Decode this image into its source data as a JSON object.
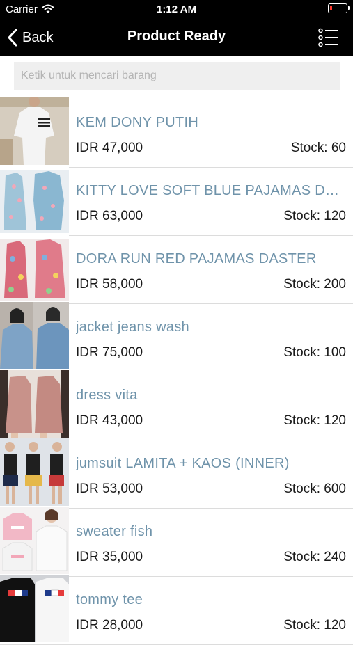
{
  "status_bar": {
    "carrier": "Carrier",
    "time": "1:12 AM",
    "battery_color": "#ff3b30"
  },
  "nav": {
    "back_label": "Back",
    "title": "Product Ready",
    "menu_icon": "list-icon"
  },
  "search": {
    "placeholder": "Ketik untuk mencari barang",
    "value": ""
  },
  "colors": {
    "product_name": "#6f93aa",
    "bar": "#000000",
    "search_bg": "#efefef"
  },
  "products": [
    {
      "name": "KEM DONY PUTIH",
      "price": "IDR 47,000",
      "stock": "Stock: 60"
    },
    {
      "name": "KITTY LOVE SOFT BLUE PAJAMAS DASTER",
      "price": "IDR 63,000",
      "stock": "Stock: 120"
    },
    {
      "name": "DORA RUN RED PAJAMAS DASTER",
      "price": "IDR 58,000",
      "stock": "Stock: 200"
    },
    {
      "name": "jacket jeans wash",
      "price": "IDR 75,000",
      "stock": "Stock: 100"
    },
    {
      "name": "dress vita",
      "price": "IDR 43,000",
      "stock": "Stock: 120"
    },
    {
      "name": "jumsuit LAMITA + KAOS (INNER)",
      "price": "IDR 53,000",
      "stock": "Stock: 600"
    },
    {
      "name": "sweater fish",
      "price": "IDR 35,000",
      "stock": "Stock: 240"
    },
    {
      "name": "tommy tee",
      "price": "IDR 28,000",
      "stock": "Stock: 120"
    }
  ]
}
